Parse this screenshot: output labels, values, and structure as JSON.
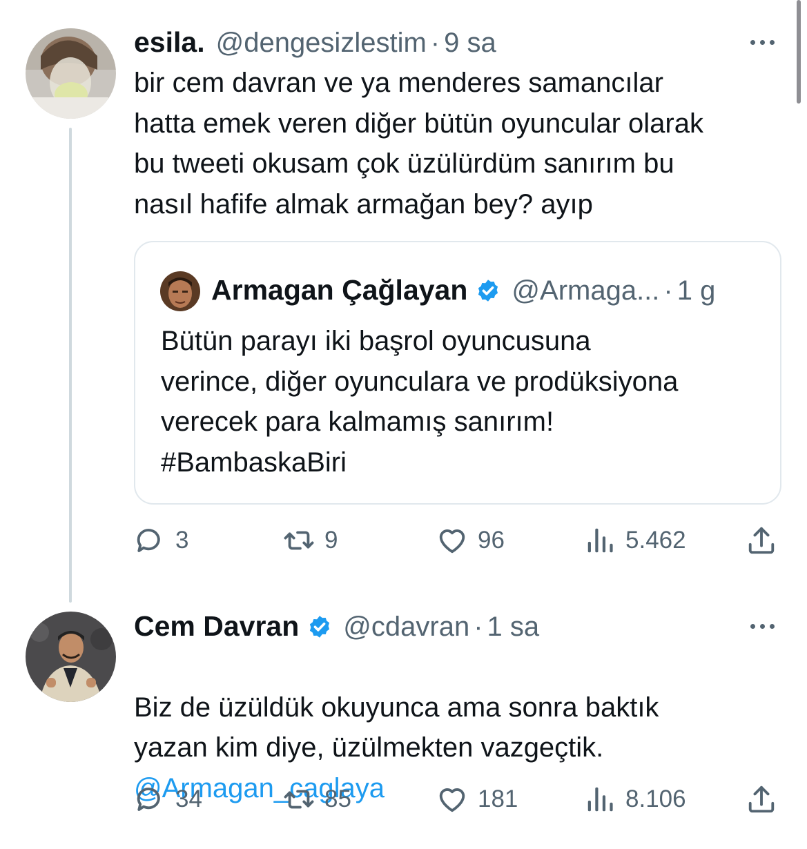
{
  "tweets": [
    {
      "name": "esila.",
      "handle": "@dengesizlestim",
      "separator": "·",
      "time": "9 sa",
      "text": "bir cem davran ve ya menderes samancılar\nhatta emek veren diğer bütün oyuncular olarak\nbu tweeti okusam çok üzülürdüm sanırım bu\nnasıl hafife almak armağan bey? ayıp",
      "stats": {
        "replies": "3",
        "retweets": "9",
        "likes": "96",
        "views": "5.462"
      }
    },
    {
      "name": "Cem Davran",
      "handle": "@cdavran",
      "separator": "·",
      "time": "1 sa",
      "text": "Biz de üzüldük okuyunca ama sonra baktık\nyazan kim diye, üzülmekten vazgeçtik.",
      "mention": "@Armagan_caglaya",
      "stats": {
        "replies": "34",
        "retweets": "85",
        "likes": "181",
        "views": "8.106"
      }
    }
  ],
  "quote": {
    "name": "Armagan Çağlayan",
    "handle": "@Armaga...",
    "separator": "·",
    "time": "1 g",
    "text": "Bütün parayı iki başrol oyuncusuna\nverince, diğer oyunculara ve prodüksiyona\nverecek para kalmamış sanırım!\n#BambaskaBiri"
  },
  "icons": {
    "reply": "reply-bubble-icon",
    "retweet": "retweet-icon",
    "like": "heart-icon",
    "views": "views-bar-chart-icon",
    "share": "share-upload-icon",
    "more": "more-dots-icon",
    "verified": "verified-badge-icon"
  },
  "colors": {
    "text": "#0f1419",
    "secondary": "#536471",
    "link": "#1d9bf0",
    "verified": "#1d9bf0",
    "border": "#e1e8ed"
  }
}
